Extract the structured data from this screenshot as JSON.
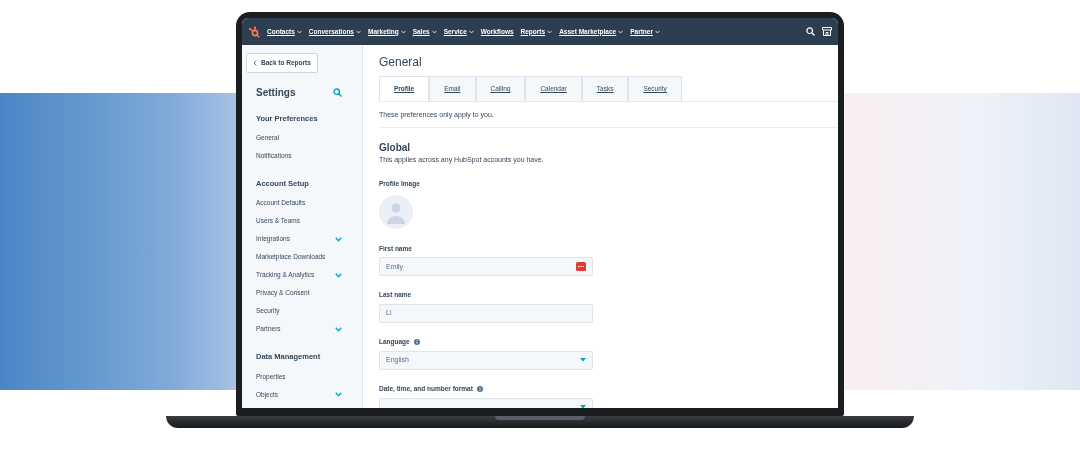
{
  "nav": {
    "items": [
      {
        "label": "Contacts",
        "dropdown": true
      },
      {
        "label": "Conversations",
        "dropdown": true
      },
      {
        "label": "Marketing",
        "dropdown": true
      },
      {
        "label": "Sales",
        "dropdown": true
      },
      {
        "label": "Service",
        "dropdown": true
      },
      {
        "label": "Workflows",
        "dropdown": false
      },
      {
        "label": "Reports",
        "dropdown": true
      },
      {
        "label": "Asset Marketplace",
        "dropdown": true
      },
      {
        "label": "Partner",
        "dropdown": true
      }
    ]
  },
  "sidebar": {
    "back_button": "Back to Reports",
    "title": "Settings",
    "sections": [
      {
        "heading": "Your Preferences",
        "items": [
          {
            "label": "General",
            "expandable": false
          },
          {
            "label": "Notifications",
            "expandable": false
          }
        ]
      },
      {
        "heading": "Account Setup",
        "items": [
          {
            "label": "Account Defaults",
            "expandable": false
          },
          {
            "label": "Users & Teams",
            "expandable": false
          },
          {
            "label": "Integrations",
            "expandable": true
          },
          {
            "label": "Marketplace Downloads",
            "expandable": false
          },
          {
            "label": "Tracking & Analytics",
            "expandable": true
          },
          {
            "label": "Privacy & Consent",
            "expandable": false
          },
          {
            "label": "Security",
            "expandable": false
          },
          {
            "label": "Partners",
            "expandable": true
          }
        ]
      },
      {
        "heading": "Data Management",
        "items": [
          {
            "label": "Properties",
            "expandable": false
          },
          {
            "label": "Objects",
            "expandable": true
          }
        ]
      }
    ]
  },
  "main": {
    "title": "General",
    "tabs": [
      {
        "label": "Profile",
        "selected": true
      },
      {
        "label": "Email",
        "selected": false
      },
      {
        "label": "Calling",
        "selected": false
      },
      {
        "label": "Calendar",
        "selected": false
      },
      {
        "label": "Tasks",
        "selected": false
      },
      {
        "label": "Security",
        "selected": false
      }
    ],
    "tab_note": "These preferences only apply to you.",
    "section_title": "Global",
    "section_note": "This applies across any HubSpot accounts you have.",
    "profile_image_label": "Profile Image",
    "fields": [
      {
        "label": "First name",
        "value": "Emily",
        "kind": "text",
        "info": false,
        "autofill_icon": true
      },
      {
        "label": "Last name",
        "value": "Li",
        "kind": "text",
        "info": false,
        "autofill_icon": false
      },
      {
        "label": "Language",
        "value": "English",
        "kind": "select",
        "info": true,
        "autofill_icon": false
      },
      {
        "label": "Date, time, and number format",
        "kind": "select",
        "info": true
      }
    ]
  }
}
